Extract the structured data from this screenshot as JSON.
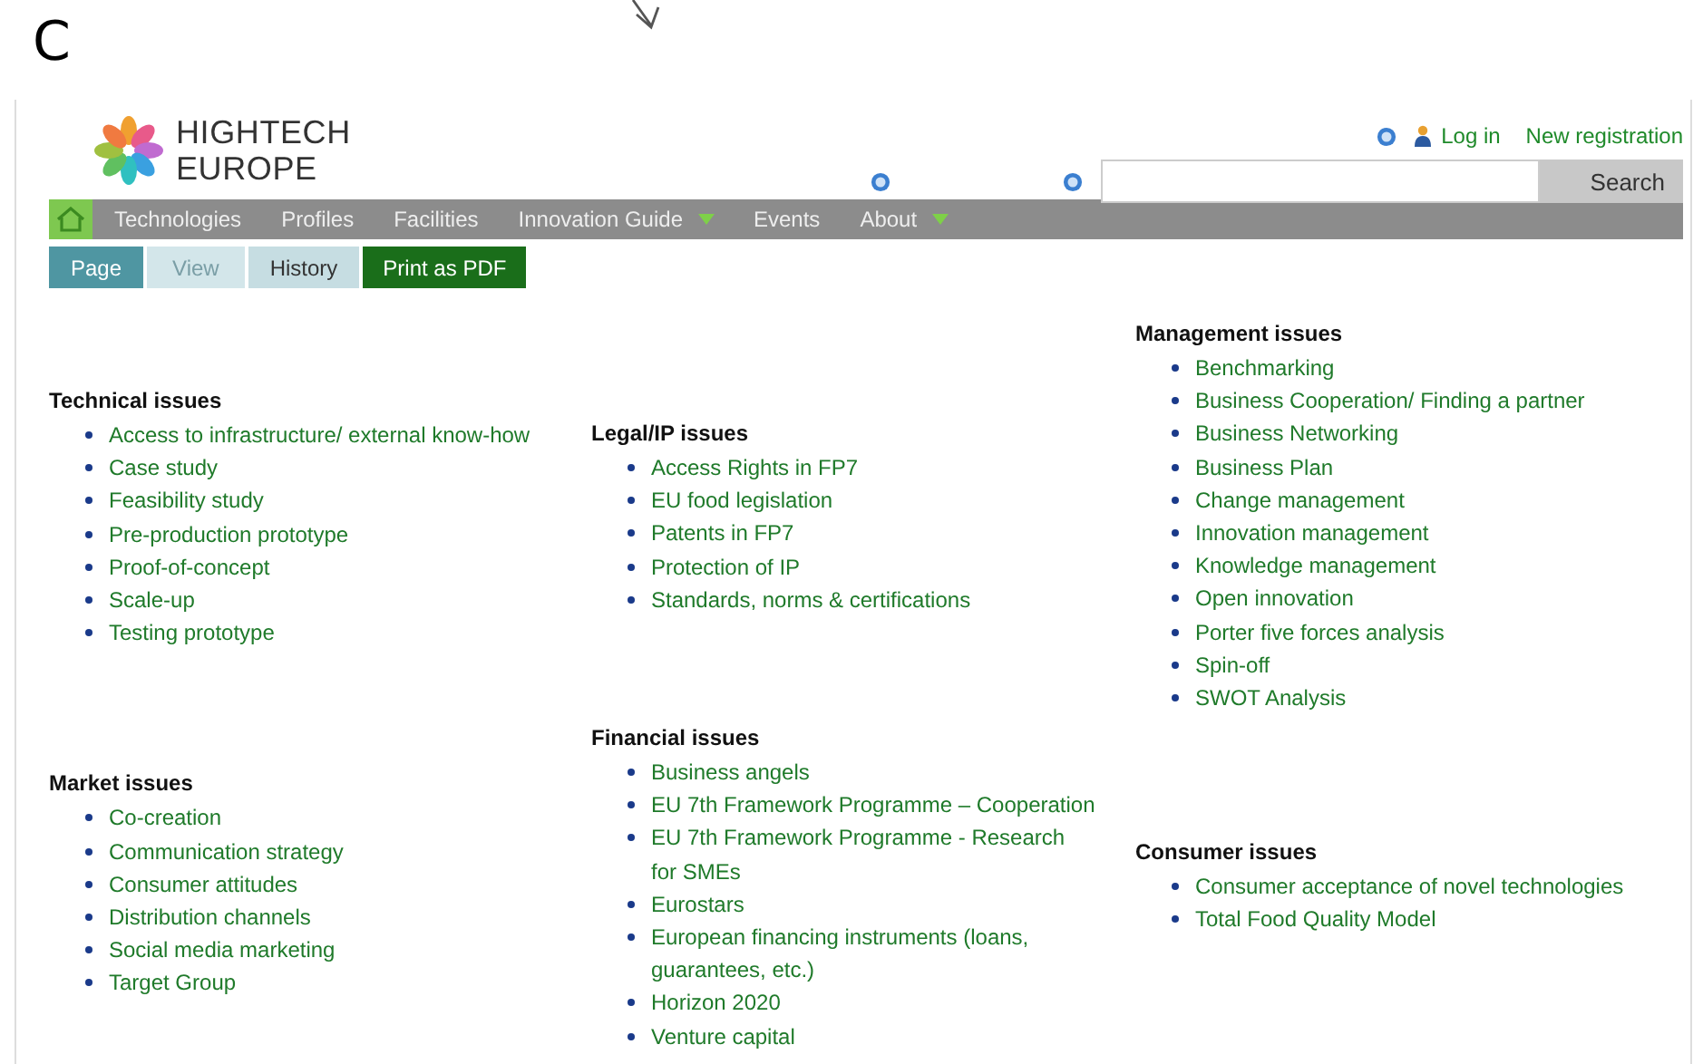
{
  "figure_label": "C",
  "logo": [
    "HIGHTECH",
    "EUROPE"
  ],
  "user_links": [
    {
      "label": "Log in",
      "kind": "login"
    },
    {
      "label": "New registration",
      "kind": "register"
    }
  ],
  "search": {
    "button": "Search"
  },
  "nav": [
    {
      "label": "Technologies",
      "has_menu": false
    },
    {
      "label": "Profiles",
      "has_menu": false
    },
    {
      "label": "Facilities",
      "has_menu": false
    },
    {
      "label": "Innovation Guide",
      "has_menu": true
    },
    {
      "label": "Events",
      "has_menu": false
    },
    {
      "label": "About",
      "has_menu": true
    }
  ],
  "tabs": [
    {
      "label": "Page",
      "kind": "tab",
      "selected": true,
      "disabled": false
    },
    {
      "label": "View",
      "kind": "tab",
      "selected": false,
      "disabled": true
    },
    {
      "label": "History",
      "kind": "tab",
      "selected": false,
      "disabled": false
    },
    {
      "label": "Print as PDF",
      "kind": "action"
    }
  ],
  "columns": [
    [
      {
        "title": "Technical issues",
        "items": [
          "Access to infrastructure/ external know-how",
          "Case study",
          "Feasibility study",
          "Pre-production prototype",
          "Proof-of-concept",
          "Scale-up",
          "Testing prototype"
        ]
      },
      {
        "title": "Market issues",
        "items": [
          "Co-creation",
          "Communication strategy",
          "Consumer attitudes",
          "Distribution channels",
          "Social media marketing",
          "Target Group"
        ]
      }
    ],
    [
      {
        "title": "Legal/IP issues",
        "items": [
          "Access Rights in FP7",
          "EU food legislation",
          "Patents in FP7",
          "Protection of IP",
          "Standards, norms & certifications"
        ]
      },
      {
        "title": "Financial issues",
        "items": [
          "Business angels",
          "EU 7th Framework Programme – Cooperation",
          "EU 7th Framework Programme - Research for SMEs",
          "Eurostars",
          "European financing instruments (loans, guarantees, etc.)",
          "Horizon 2020",
          "Venture capital"
        ]
      }
    ],
    [
      {
        "title": "Management issues",
        "items": [
          "Benchmarking",
          "Business Cooperation/ Finding a partner",
          "Business Networking",
          "Business Plan",
          "Change management",
          "Innovation management",
          "Knowledge management",
          "Open innovation",
          "Porter five forces analysis",
          "Spin-off",
          "SWOT Analysis"
        ]
      },
      {
        "title": "Consumer issues",
        "items": [
          "Consumer acceptance of novel technologies",
          "Total Food Quality Model"
        ]
      }
    ]
  ]
}
